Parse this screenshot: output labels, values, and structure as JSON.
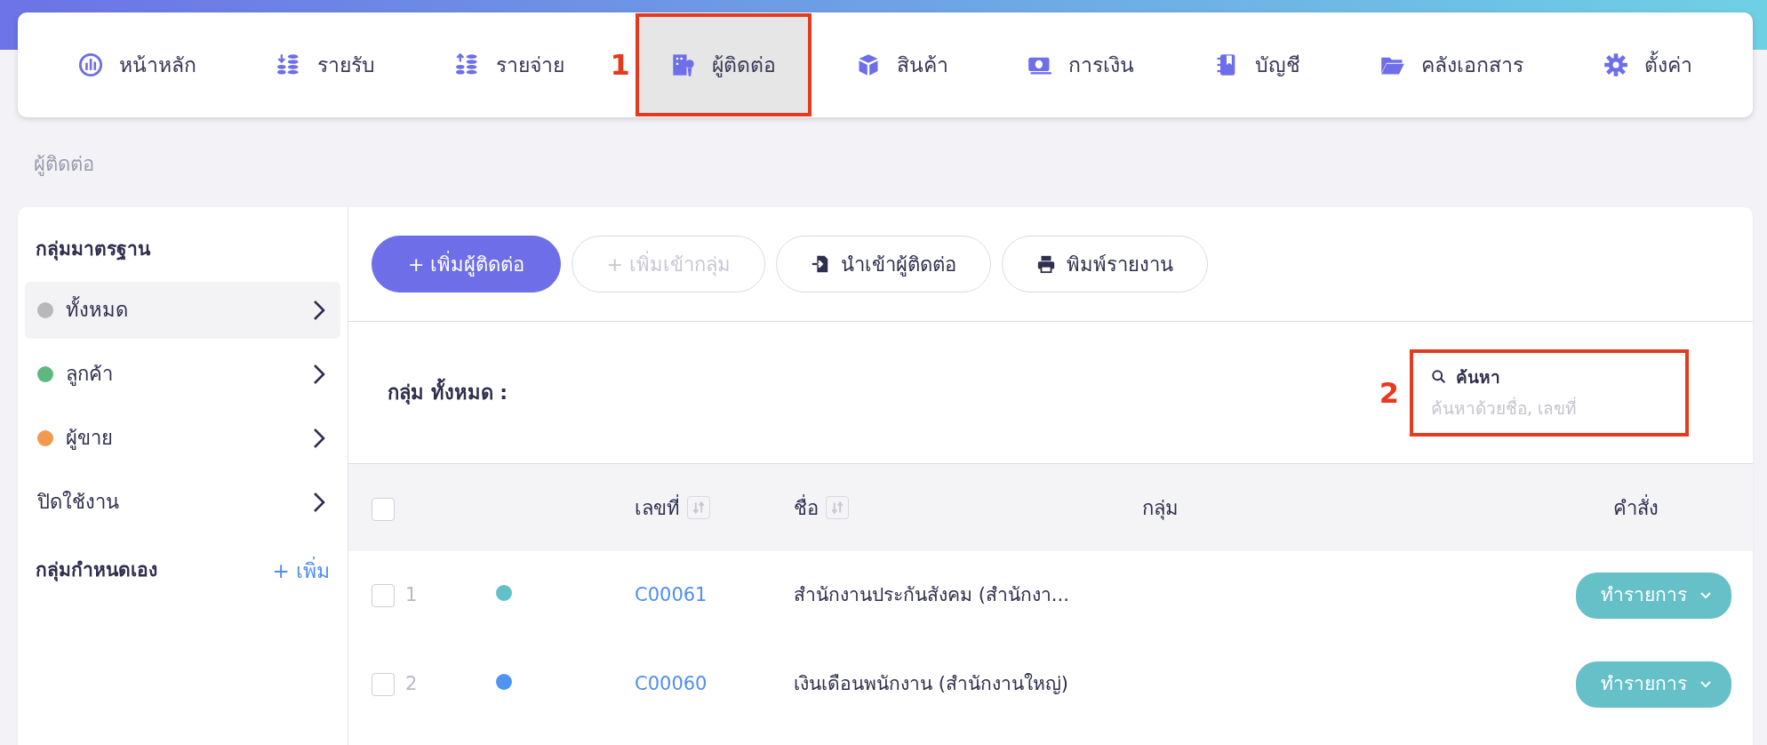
{
  "nav": {
    "items": [
      {
        "label": "หน้าหลัก",
        "selected": false
      },
      {
        "label": "รายรับ",
        "selected": false
      },
      {
        "label": "รายจ่าย",
        "selected": false
      },
      {
        "label": "ผู้ติดต่อ",
        "selected": true,
        "callout": "1"
      },
      {
        "label": "สินค้า",
        "selected": false
      },
      {
        "label": "การเงิน",
        "selected": false
      },
      {
        "label": "บัญชี",
        "selected": false
      },
      {
        "label": "คลังเอกสาร",
        "selected": false
      },
      {
        "label": "ตั้งค่า",
        "selected": false
      }
    ]
  },
  "breadcrumb": "ผู้ติดต่อ",
  "sidebar": {
    "standard_title": "กลุ่มมาตรฐาน",
    "items": [
      {
        "label": "ทั้งหมด",
        "selected": true,
        "color": "#b8b8b8"
      },
      {
        "label": "ลูกค้า",
        "selected": false,
        "color": "#5cb87e"
      },
      {
        "label": "ผู้ขาย",
        "selected": false,
        "color": "#f0994f"
      },
      {
        "label": "ปิดใช้งาน",
        "selected": false
      }
    ],
    "custom_title": "กลุ่มกำหนดเอง",
    "add_label": "+ เพิ่ม"
  },
  "toolbar": [
    {
      "label": "+ เพิ่มผู้ติดต่อ",
      "kind": "primary",
      "disabled": false
    },
    {
      "label": "+ เพิ่มเข้ากลุ่ม",
      "kind": "outline",
      "disabled": true
    },
    {
      "label": "นำเข้าผู้ติดต่อ",
      "kind": "import",
      "disabled": false
    },
    {
      "label": "พิมพ์รายงาน",
      "kind": "print",
      "disabled": false
    }
  ],
  "group_heading": "กลุ่ม ทั้งหมด :",
  "search": {
    "label": "ค้นหา",
    "placeholder": "ค้นหาด้วยชื่อ, เลขที่",
    "callout": "2"
  },
  "table": {
    "columns": [
      "เลขที่",
      "ชื่อ",
      "กลุ่ม",
      "คำสั่ง"
    ],
    "header_checked": false,
    "rows": [
      {
        "checked": false,
        "number": "1",
        "color": "#62c0c8",
        "code": "C00061",
        "name": "สำนักงานประกันสังคม (สำนักงา...",
        "action": "ทำรายการ"
      },
      {
        "checked": false,
        "number": "2",
        "color": "#4f94ee",
        "code": "C00060",
        "name": "เงินเดือนพนักงาน (สำนักงานใหญ่)",
        "action": "ทำรายการ"
      }
    ]
  }
}
